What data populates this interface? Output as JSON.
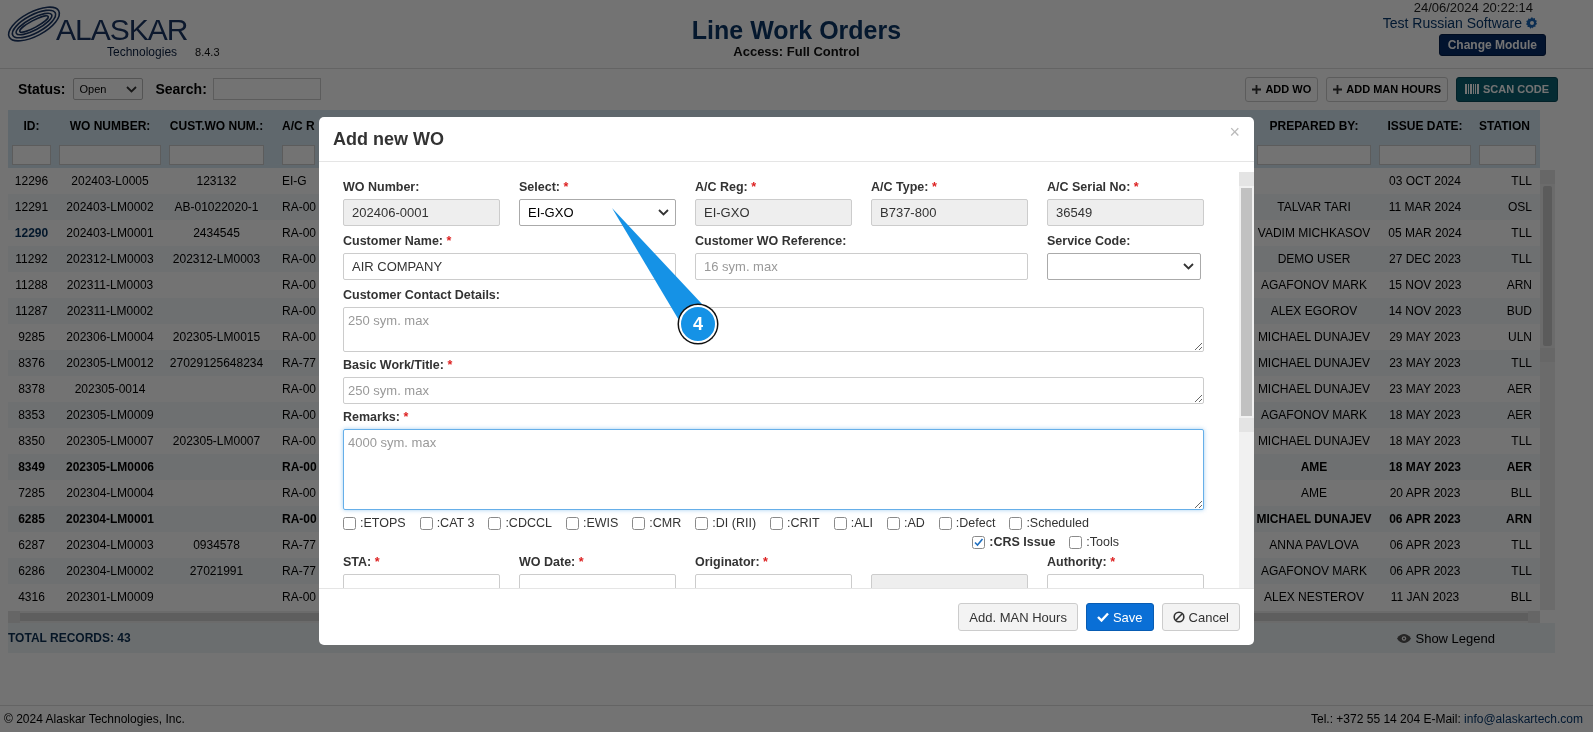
{
  "header": {
    "brand": "ALASKAR",
    "brand_sub": "Technologies",
    "version": "8.4.3",
    "title": "Line Work Orders",
    "access": "Access: Full Control",
    "datetime": "24/06/2024 20:22:14",
    "user": "Test Russian Software",
    "module_button": "Change Module"
  },
  "toolbar": {
    "status_label": "Status:",
    "status_value": "Open",
    "search_label": "Search:",
    "buttons": [
      {
        "label": "ADD WO",
        "kind": "plus"
      },
      {
        "label": "ADD MAN HOURS",
        "kind": "plus"
      },
      {
        "label": "SCAN CODE",
        "kind": "scan"
      }
    ]
  },
  "table": {
    "columns": [
      "ID:",
      "WO NUMBER:",
      "CUST.WO NUM.:",
      "A/C R",
      "PREPARED BY:",
      "ISSUE DATE:",
      "STATION"
    ],
    "rows": [
      {
        "id": "12296",
        "wo_number": "202403-L0005",
        "cust_wo_number": "123132",
        "column_4": "EI-G",
        "issue_date": "03 OCT 2024",
        "station": "TLL",
        "bold": false,
        "id_highlighted": false
      },
      {
        "id": "12291",
        "wo_number": "202403-LM0002",
        "cust_wo_number": "AB-01022020-1",
        "column_4": "RA-00",
        "prepared_by": "TALVAR TARI",
        "issue_date": "11 MAR 2024",
        "station": "OSL",
        "bold": false,
        "id_highlighted": false
      },
      {
        "id": "12290",
        "wo_number": "202403-LM0001",
        "cust_wo_number": "2434545",
        "column_4": "RA-00",
        "prepared_by": "VADIM MICHKASOV",
        "issue_date": "05 MAR 2024",
        "station": "TLL",
        "bold": false,
        "id_highlighted": true
      },
      {
        "id": "11292",
        "wo_number": "202312-LM0003",
        "cust_wo_number": "202312-LM0003",
        "column_4": "RA-00",
        "prepared_by": "DEMO USER",
        "issue_date": "27 DEC 2023",
        "station": "TLL",
        "bold": false,
        "id_highlighted": false
      },
      {
        "id": "11288",
        "wo_number": "202311-LM0003",
        "column_4": "RA-00",
        "prepared_by": "AGAFONOV MARK",
        "issue_date": "15 NOV 2023",
        "station": "ARN",
        "bold": false,
        "id_highlighted": false
      },
      {
        "id": "11287",
        "wo_number": "202311-LM0002",
        "column_4": "RA-00",
        "prepared_by": "ALEX EGOROV",
        "issue_date": "14 NOV 2023",
        "station": "BUD",
        "bold": false,
        "id_highlighted": false
      },
      {
        "id": "9285",
        "wo_number": "202306-LM0004",
        "cust_wo_number": "202305-LM0015",
        "column_4": "RA-00",
        "prepared_by": "MICHAEL DUNAJEV",
        "issue_date": "29 MAY 2023",
        "station": "ULN",
        "bold": false,
        "id_highlighted": false
      },
      {
        "id": "8376",
        "wo_number": "202305-LM0012",
        "cust_wo_number": "27029125648234",
        "column_4": "RA-77",
        "prepared_by": "MICHAEL DUNAJEV",
        "issue_date": "23 MAY 2023",
        "station": "TLL",
        "bold": false,
        "id_highlighted": false
      },
      {
        "id": "8378",
        "wo_number": "202305-0014",
        "column_4": "RA-00",
        "prepared_by": "MICHAEL DUNAJEV",
        "issue_date": "23 MAY 2023",
        "station": "AER",
        "bold": false,
        "id_highlighted": false
      },
      {
        "id": "8353",
        "wo_number": "202305-LM0009",
        "column_4": "RA-00",
        "prepared_by": "AGAFONOV MARK",
        "issue_date": "18 MAY 2023",
        "station": "AER",
        "bold": false,
        "id_highlighted": false
      },
      {
        "id": "8350",
        "wo_number": "202305-LM0007",
        "cust_wo_number": "202305-LM0007",
        "column_4": "RA-00",
        "prepared_by": "MICHAEL DUNAJEV",
        "issue_date": "18 MAY 2023",
        "station": "TLL",
        "bold": false,
        "id_highlighted": false
      },
      {
        "id": "8349",
        "wo_number": "202305-LM0006",
        "column_4": "RA-00",
        "prepared_by": "AME",
        "issue_date": "18 MAY 2023",
        "station": "AER",
        "bold": true,
        "id_highlighted": false
      },
      {
        "id": "7285",
        "wo_number": "202304-LM0004",
        "column_4": "RA-00",
        "prepared_by": "AME",
        "issue_date": "20 APR 2023",
        "station": "BLL",
        "bold": false,
        "id_highlighted": false
      },
      {
        "id": "6285",
        "wo_number": "202304-LM0001",
        "column_4": "RA-00",
        "prepared_by": "MICHAEL DUNAJEV",
        "issue_date": "06 APR 2023",
        "station": "ARN",
        "bold": true,
        "id_highlighted": false
      },
      {
        "id": "6287",
        "wo_number": "202304-LM0003",
        "cust_wo_number": "0934578",
        "column_4": "RA-77",
        "prepared_by": "ANNA PAVLOVA",
        "issue_date": "06 APR 2023",
        "station": "TLL",
        "bold": false,
        "id_highlighted": false
      },
      {
        "id": "6286",
        "wo_number": "202304-LM0002",
        "cust_wo_number": "27021991",
        "column_4": "RA-77",
        "prepared_by": "AGAFONOV MARK",
        "issue_date": "06 APR 2023",
        "station": "TLL",
        "bold": false,
        "id_highlighted": false
      },
      {
        "id": "4316",
        "wo_number": "202301-LM0009",
        "column_4": "RA-00",
        "prepared_by": "ALEX NESTEROV",
        "issue_date": "11 JAN 2023",
        "station": "BLL",
        "bold": false,
        "id_highlighted": false
      }
    ],
    "total": "TOTAL RECORDS: 43",
    "legend": "Show Legend"
  },
  "modal": {
    "title": "Add new WO",
    "close": "×",
    "form_rows": [
      {
        "fields": [
          {
            "label": "WO Number:",
            "kind": "readonly",
            "value": "202406-0001"
          },
          {
            "label": "Select:",
            "required_mark": "*",
            "kind": "select",
            "value": "EI-GXO"
          },
          {
            "label": "A/C Reg:",
            "required_mark": "*",
            "kind": "readonly",
            "value": "EI-GXO"
          },
          {
            "label": "A/C Type:",
            "required_mark": "*",
            "kind": "readonly",
            "value": "B737-800"
          },
          {
            "label": "A/C Serial No:",
            "required_mark": "*",
            "kind": "readonly",
            "value": "36549"
          }
        ]
      },
      {
        "fields": [
          {
            "label": "Customer Name:",
            "required_mark": "*",
            "kind": "input",
            "value": "AIR COMPANY"
          },
          {
            "label": "Customer WO Reference:",
            "kind": "input",
            "placeholder": "16 sym. max"
          },
          {
            "label": "Service Code:",
            "kind": "select"
          }
        ]
      },
      {
        "fields": [
          {
            "label": "Customer Contact Details:",
            "kind": "textarea",
            "placeholder": "250 sym. max",
            "focused": false
          }
        ]
      },
      {
        "fields": [
          {
            "label": "Basic Work/Title:",
            "required_mark": "*",
            "kind": "textarea",
            "placeholder": "250 sym. max",
            "focused": false
          }
        ]
      },
      {
        "fields": [
          {
            "label": "Remarks:",
            "required_mark": "*",
            "kind": "textarea",
            "placeholder": "4000 sym. max",
            "focused": true
          }
        ]
      }
    ],
    "flag_rows": [
      [
        {
          "label": ":ETOPS",
          "checked": false
        },
        {
          "label": ":CAT 3",
          "checked": false
        },
        {
          "label": ":CDCCL",
          "checked": false
        },
        {
          "label": ":EWIS",
          "checked": false
        },
        {
          "label": ":CMR",
          "checked": false
        },
        {
          "label": ":DI (RII)",
          "checked": false
        },
        {
          "label": ":CRIT",
          "checked": false
        },
        {
          "label": ":ALI",
          "checked": false
        },
        {
          "label": ":AD",
          "checked": false
        },
        {
          "label": ":Defect",
          "checked": false
        },
        {
          "label": ":Scheduled",
          "checked": false
        }
      ],
      [
        {
          "label": ":CRS Issue",
          "checked": true
        },
        {
          "label": ":Tools",
          "checked": false
        }
      ]
    ],
    "bottom_fields": [
      {
        "label": "STA:",
        "required_mark": "*",
        "kind": "input"
      },
      {
        "label": "WO Date:",
        "required_mark": "*",
        "kind": "input"
      },
      {
        "label": "Originator:",
        "required_mark": "*",
        "kind": "input"
      },
      {
        "kind": "readonly"
      },
      {
        "label": "Authority:",
        "required_mark": "*",
        "kind": "input"
      }
    ],
    "buttons": [
      {
        "label": "Add. MAN Hours",
        "kind": "default"
      },
      {
        "label": "Save",
        "kind": "save"
      },
      {
        "label": "Cancel",
        "kind": "cancel"
      }
    ]
  },
  "callout": {
    "number": "4"
  },
  "footer": {
    "copyright": "© 2024 Alaskar Technologies, Inc.",
    "contact": "Tel.: +372 55 14 204 E-Mail:",
    "email": "info@alaskartech.com"
  }
}
